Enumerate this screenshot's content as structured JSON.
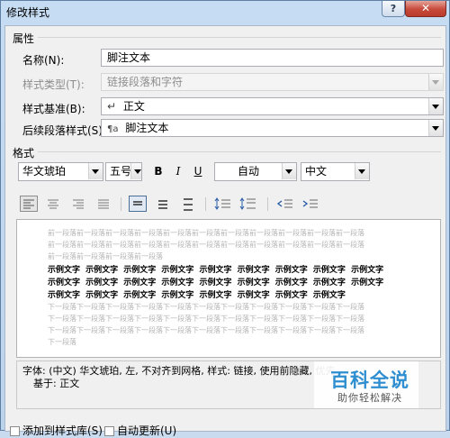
{
  "window": {
    "title": "修改样式",
    "help_label": "?",
    "close_label": "✕"
  },
  "properties": {
    "group_label": "属性",
    "name": {
      "label": "名称(N):",
      "value": "脚注文本"
    },
    "style_type": {
      "label": "样式类型(T):",
      "value": "链接段落和字符"
    },
    "based_on": {
      "label": "样式基准(B):",
      "icon": "↵",
      "value": "正文"
    },
    "next_style": {
      "label": "后续段落样式(S):",
      "icon": "¶a",
      "value": "脚注文本"
    }
  },
  "format": {
    "group_label": "格式",
    "font": "华文琥珀",
    "size": "五号",
    "bold_label": "B",
    "italic_label": "I",
    "underline_label": "U",
    "color": "自动",
    "script": "中文"
  },
  "preview": {
    "prev_lines": [
      "前一段落前一段落前一段落前一段落前一段落前一段落前一段落前一段落前一段落前一段落前一段落",
      "前一段落前一段落前一段落前一段落前一段落前一段落前一段落前一段落前一段落前一段落前一段落",
      "前一段落前一段落前一段落前一段落"
    ],
    "sample_lines": [
      "示例文字 示例文字 示例文字 示例文字 示例文字 示例文字 示例文字 示例文字 示例文字",
      "示例文字 示例文字 示例文字 示例文字 示例文字 示例文字 示例文字 示例文字 示例文字",
      "示例文字 示例文字 示例文字 示例文字 示例文字 示例文字 示例文字 示例文字"
    ],
    "next_lines": [
      "下一段落下一段落下一段落下一段落下一段落下一段落下一段落下一段落下一段落下一段落下一段落",
      "下一段落下一段落下一段落下一段落下一段落下一段落下一段落下一段落下一段落下一段落下一段落",
      "下一段落下一段落下一段落下一段落下一段落下一段落下一段落下一段落下一段落下一段落下一段落",
      "下一段落"
    ]
  },
  "description": {
    "line1": "字体: (中文) 华文琥珀, 左, 不对齐到网格, 样式: 链接, 使用前隐藏, 优先",
    "line2": "基于: 正文"
  },
  "watermark": {
    "title": "百科全说",
    "subtitle": "助你轻松解决"
  },
  "options": {
    "add_to_gallery": "添加到样式库(S)",
    "auto_update": "自动更新(U)"
  }
}
